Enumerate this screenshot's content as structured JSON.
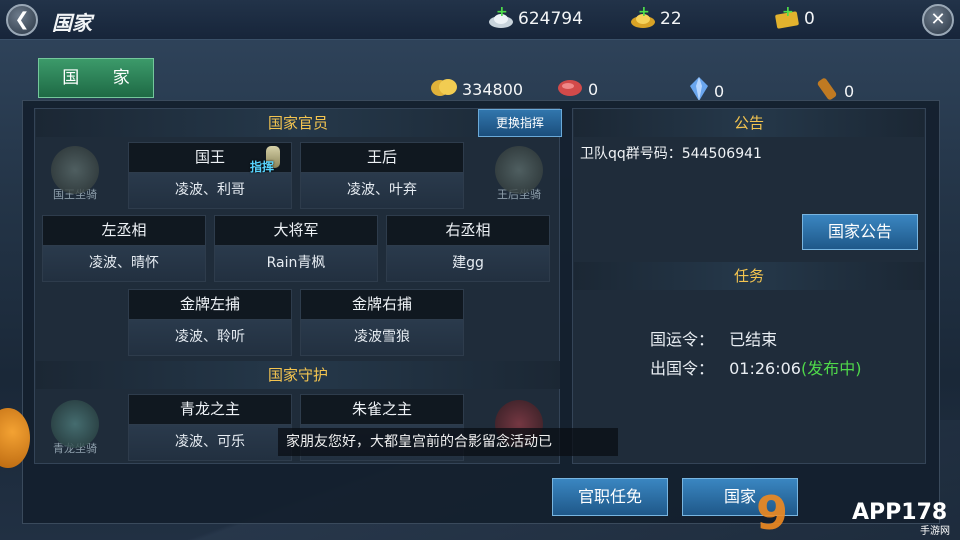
{
  "header": {
    "title": "国家",
    "currency": [
      {
        "name": "silver",
        "icon": "silver-ingot-icon",
        "value": "624794"
      },
      {
        "name": "gold",
        "icon": "gold-ingot-icon",
        "value": "22"
      },
      {
        "name": "ticket",
        "icon": "gold-ticket-icon",
        "value": "0"
      }
    ]
  },
  "tab": {
    "label": "国 家"
  },
  "resources": [
    {
      "icon": "gold-coins-icon",
      "value": "334800"
    },
    {
      "icon": "meat-icon",
      "value": "0"
    },
    {
      "icon": "crystal-icon",
      "value": "0"
    },
    {
      "icon": "scroll-icon",
      "value": "0"
    }
  ],
  "officials": {
    "header": "国家官员",
    "change_button": "更换指挥",
    "command_badge": "指挥",
    "king_mount": "国王坐骑",
    "queen_mount": "王后坐骑",
    "slots": [
      {
        "title": "国王",
        "names": "凌波、利哥"
      },
      {
        "title": "王后",
        "names": "凌波、叶弃"
      },
      {
        "title": "左丞相",
        "names": "凌波、晴怀"
      },
      {
        "title": "大将军",
        "names": "Rain青枫"
      },
      {
        "title": "右丞相",
        "names": "建gg"
      },
      {
        "title": "金牌左捕",
        "names": "凌波、聆听"
      },
      {
        "title": "金牌右捕",
        "names": "凌波雪狼"
      }
    ]
  },
  "guardians": {
    "header": "国家守护",
    "left_mount": "青龙坐骑",
    "slots": [
      {
        "title": "青龙之主",
        "names": "凌波、可乐"
      },
      {
        "title": "朱雀之主",
        "names": ""
      }
    ]
  },
  "announcement": {
    "header": "公告",
    "text": "卫队qq群号码：544506941",
    "button": "国家公告"
  },
  "tasks": {
    "header": "任务",
    "items": [
      {
        "key": "国运令：",
        "value": "已结束",
        "status": ""
      },
      {
        "key": "出国令：",
        "value": "01:26:06",
        "status": "(发布中)"
      }
    ]
  },
  "bottom": {
    "appoint_button": "官职任免",
    "country_button": "国家"
  },
  "marquee": "家朋友您好，大都皇宫前的合影留念活动已",
  "watermark": {
    "text": "APP178",
    "sub": "手游网"
  }
}
